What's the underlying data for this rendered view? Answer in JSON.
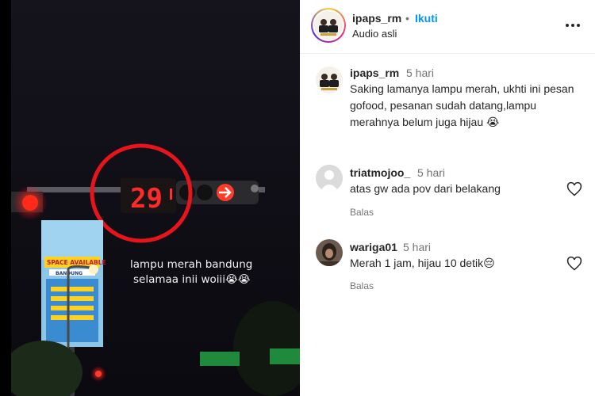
{
  "header": {
    "username": "ipaps_rm",
    "dot": "•",
    "follow_label": "Ikuti",
    "audio_label": "Audio asli"
  },
  "video": {
    "countdown": "29",
    "overlay_line1": "lampu merah bandung",
    "overlay_line2": "selamaa inii woiii😭😭",
    "billboard_text": "SPACE AVAILABLE",
    "billboard_sub": "BANDUNG"
  },
  "caption": {
    "username": "ipaps_rm",
    "time": "5 hari",
    "text": "Saking lamanya lampu merah, ukhti ini pesan gofood, pesanan sudah datang,lampu merahnya belum juga hijau 😭"
  },
  "comments": [
    {
      "username": "triatmojoo_",
      "time": "5 hari",
      "text": "atas gw ada pov dari belakang",
      "reply_label": "Balas"
    },
    {
      "username": "wariga01",
      "time": "5 hari",
      "text": "Merah 1 jam, hijau 10 detik😔",
      "reply_label": "Balas"
    }
  ]
}
